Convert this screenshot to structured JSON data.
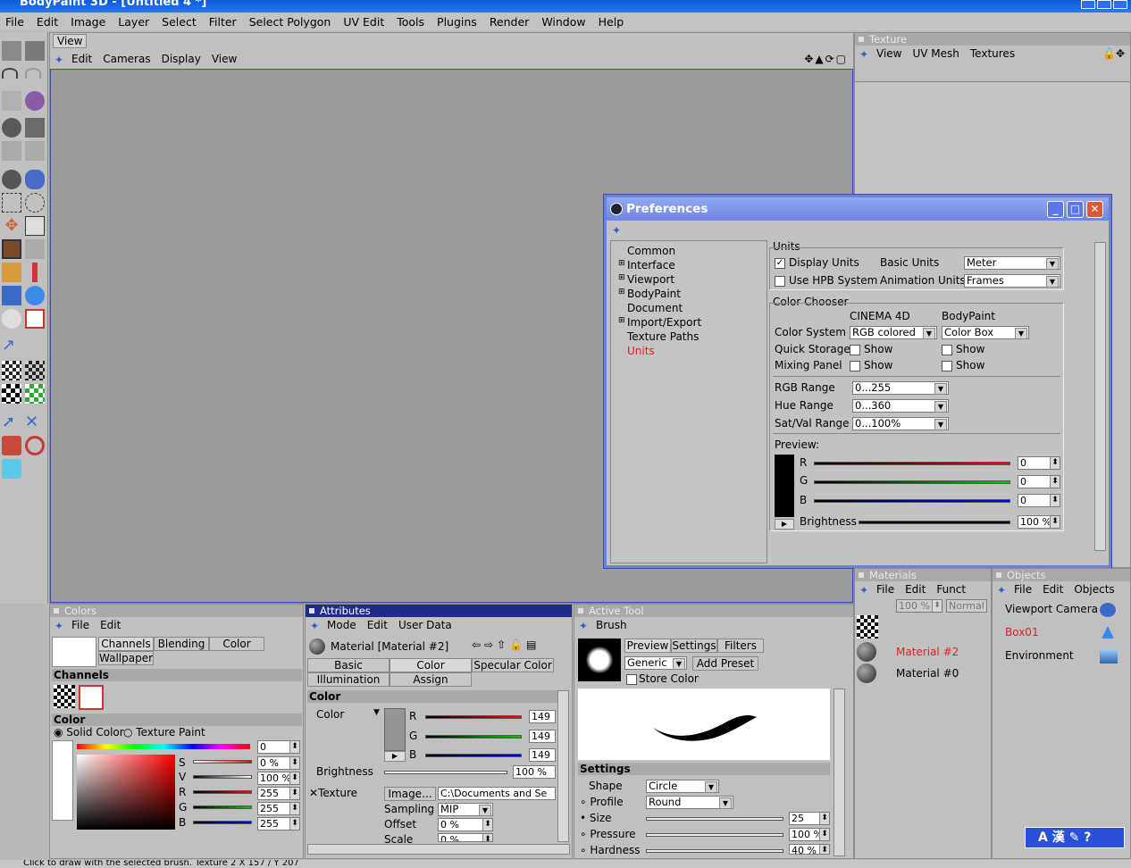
{
  "app": {
    "title": "BodyPaint 3D - [Untitled 4 *]",
    "status_text": "Click to draw with the selected brush. Texture 2   X 157 / Y 207"
  },
  "menubar": [
    "File",
    "Edit",
    "Image",
    "Layer",
    "Select",
    "Filter",
    "Select Polygon",
    "UV Edit",
    "Tools",
    "Plugins",
    "Render",
    "Window",
    "Help"
  ],
  "viewport": {
    "tab": "View",
    "menu": [
      "Edit",
      "Cameras",
      "Display",
      "View"
    ]
  },
  "texture": {
    "header": "Texture",
    "menu": [
      "View",
      "UV Mesh",
      "Textures"
    ]
  },
  "preferences": {
    "title": "Preferences",
    "tree": [
      {
        "label": "Common",
        "expandable": false
      },
      {
        "label": "Interface",
        "expandable": true
      },
      {
        "label": "Viewport",
        "expandable": true
      },
      {
        "label": "BodyPaint",
        "expandable": true
      },
      {
        "label": "Document",
        "expandable": false
      },
      {
        "label": "Import/Export",
        "expandable": true
      },
      {
        "label": "Texture Paths",
        "expandable": false
      },
      {
        "label": "Units",
        "expandable": false,
        "selected": true
      }
    ],
    "units": {
      "group_label": "Units",
      "display_units": "Display Units",
      "display_units_checked": true,
      "basic_units_label": "Basic Units",
      "basic_units_value": "Meter",
      "use_hpb": "Use HPB System",
      "use_hpb_checked": false,
      "animation_units_label": "Animation Units",
      "animation_units_value": "Frames"
    },
    "color_chooser": {
      "group_label": "Color Chooser",
      "col_c4d": "CINEMA 4D",
      "col_bp": "BodyPaint",
      "color_system_label": "Color System",
      "color_system_c4d": "RGB colored",
      "color_system_bp": "Color Box",
      "quick_storage_label": "Quick Storage",
      "mixing_panel_label": "Mixing Panel",
      "show": "Show",
      "rgb_range_label": "RGB Range",
      "rgb_range": "0...255",
      "hue_range_label": "Hue Range",
      "hue_range": "0...360",
      "satval_range_label": "Sat/Val Range",
      "satval_range": "0...100%",
      "preview_label": "Preview:",
      "r_label": "R",
      "g_label": "G",
      "b_label": "B",
      "r": "0",
      "g": "0",
      "b": "0",
      "brightness_label": "Brightness",
      "brightness": "100 %"
    }
  },
  "colors_panel": {
    "header": "Colors",
    "menu": [
      "File",
      "Edit"
    ],
    "tabs": [
      "Channels",
      "Blending",
      "Color",
      "Wallpaper"
    ],
    "channels_label": "Channels",
    "color_label": "Color",
    "solid_color": "Solid Color",
    "texture_paint": "Texture Paint",
    "hue_value": "0",
    "s_label": "S",
    "v_label": "V",
    "r_label": "R",
    "g_label": "G",
    "b_label": "B",
    "s": "0 %",
    "v": "100 %",
    "r": "255",
    "g": "255",
    "b": "255"
  },
  "attributes_panel": {
    "header": "Attributes",
    "menu": [
      "Mode",
      "Edit",
      "User Data"
    ],
    "material": "Material [Material #2]",
    "tabs": [
      "Basic",
      "Color",
      "Specular Color",
      "Illumination",
      "Assign"
    ],
    "section": "Color",
    "color_label": "Color",
    "r_label": "R",
    "g_label": "G",
    "b_label": "B",
    "r": "149",
    "g": "149",
    "b": "149",
    "brightness_label": "Brightness",
    "brightness": "100 %",
    "texture_label": "Texture",
    "image_button": "Image...",
    "texture_path": "C:\\Documents and Se",
    "sampling_label": "Sampling",
    "sampling": "MIP",
    "offset_label": "Offset",
    "offset": "0 %",
    "scale_label": "Scale",
    "scale": "0 %"
  },
  "active_tool": {
    "header": "Active Tool",
    "tool": "Brush",
    "tabs": [
      "Preview",
      "Settings",
      "Filters"
    ],
    "preset": "Generic",
    "add_preset": "Add Preset",
    "store_color": "Store Color",
    "settings_label": "Settings",
    "shape_label": "Shape",
    "shape": "Circle",
    "profile_label": "Profile",
    "profile": "Round",
    "size_label": "Size",
    "size": "25",
    "pressure_label": "Pressure",
    "pressure": "100 %",
    "hardness_label": "Hardness",
    "hardness": "40 %"
  },
  "materials": {
    "header": "Materials",
    "menu": [
      "File",
      "Edit",
      "Funct"
    ],
    "opacity": "100 %",
    "mode": "Normal",
    "items": [
      "Material #2",
      "Material #0"
    ]
  },
  "objects": {
    "header": "Objects",
    "menu": [
      "File",
      "Edit",
      "Objects"
    ],
    "items": [
      "Viewport Camera",
      "Box01",
      "Environment"
    ]
  },
  "ime": {
    "text": "A 漢"
  }
}
